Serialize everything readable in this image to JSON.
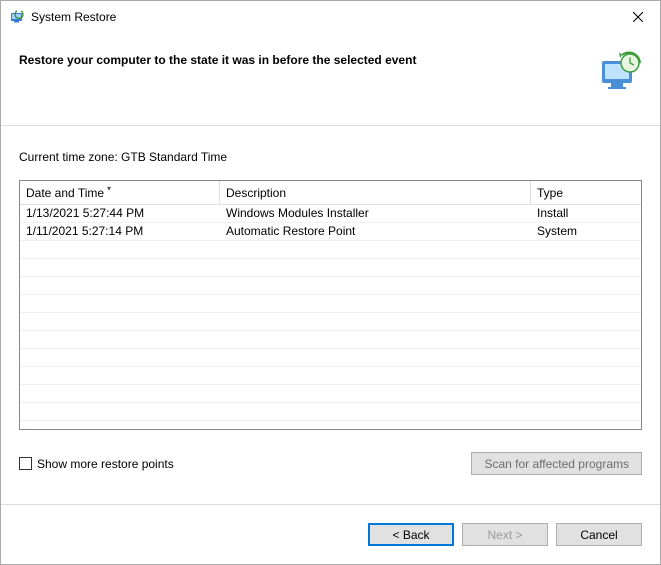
{
  "window": {
    "title": "System Restore"
  },
  "header": {
    "heading": "Restore your computer to the state it was in before the selected event"
  },
  "timezone": {
    "label": "Current time zone: GTB Standard Time"
  },
  "grid": {
    "columns": {
      "datetime": "Date and Time",
      "description": "Description",
      "type": "Type"
    },
    "rows": [
      {
        "datetime": "1/13/2021 5:27:44 PM",
        "description": "Windows Modules Installer",
        "type": "Install"
      },
      {
        "datetime": "1/11/2021 5:27:14 PM",
        "description": "Automatic Restore Point",
        "type": "System"
      }
    ]
  },
  "controls": {
    "show_more_label": "Show more restore points",
    "scan_label": "Scan for affected programs"
  },
  "footer": {
    "back": "< Back",
    "next": "Next >",
    "cancel": "Cancel"
  }
}
